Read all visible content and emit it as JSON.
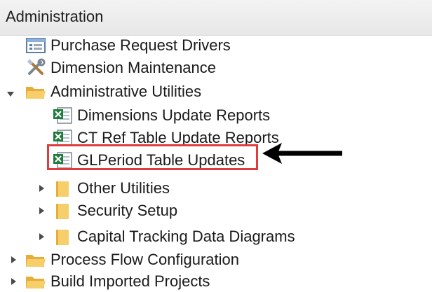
{
  "header": {
    "title": "Administration"
  },
  "tree": {
    "purchase_request_drivers": "Purchase Request Drivers",
    "dimension_maintenance": "Dimension Maintenance",
    "administrative_utilities": "Administrative Utilities",
    "dimensions_update_reports": "Dimensions Update Reports",
    "ct_ref_table_update_reports": "CT Ref Table Update Reports",
    "glperiod_table_updates": "GLPeriod Table Updates",
    "other_utilities": "Other Utilities",
    "security_setup": "Security Setup",
    "capital_tracking_data_diagrams": "Capital Tracking Data Diagrams",
    "process_flow_configuration": "Process Flow Configuration",
    "build_imported_projects": "Build Imported Projects"
  },
  "colors": {
    "highlight": "#e03c3c",
    "arrow": "#000000",
    "folder": "#f2c14e",
    "excel_green": "#1e7b3a"
  },
  "icons": {
    "form": "form-icon",
    "tools": "tools-icon",
    "folder": "folder-icon",
    "excel": "excel-report-icon",
    "expand": "chevron-right-icon",
    "collapse": "chevron-down-icon"
  }
}
